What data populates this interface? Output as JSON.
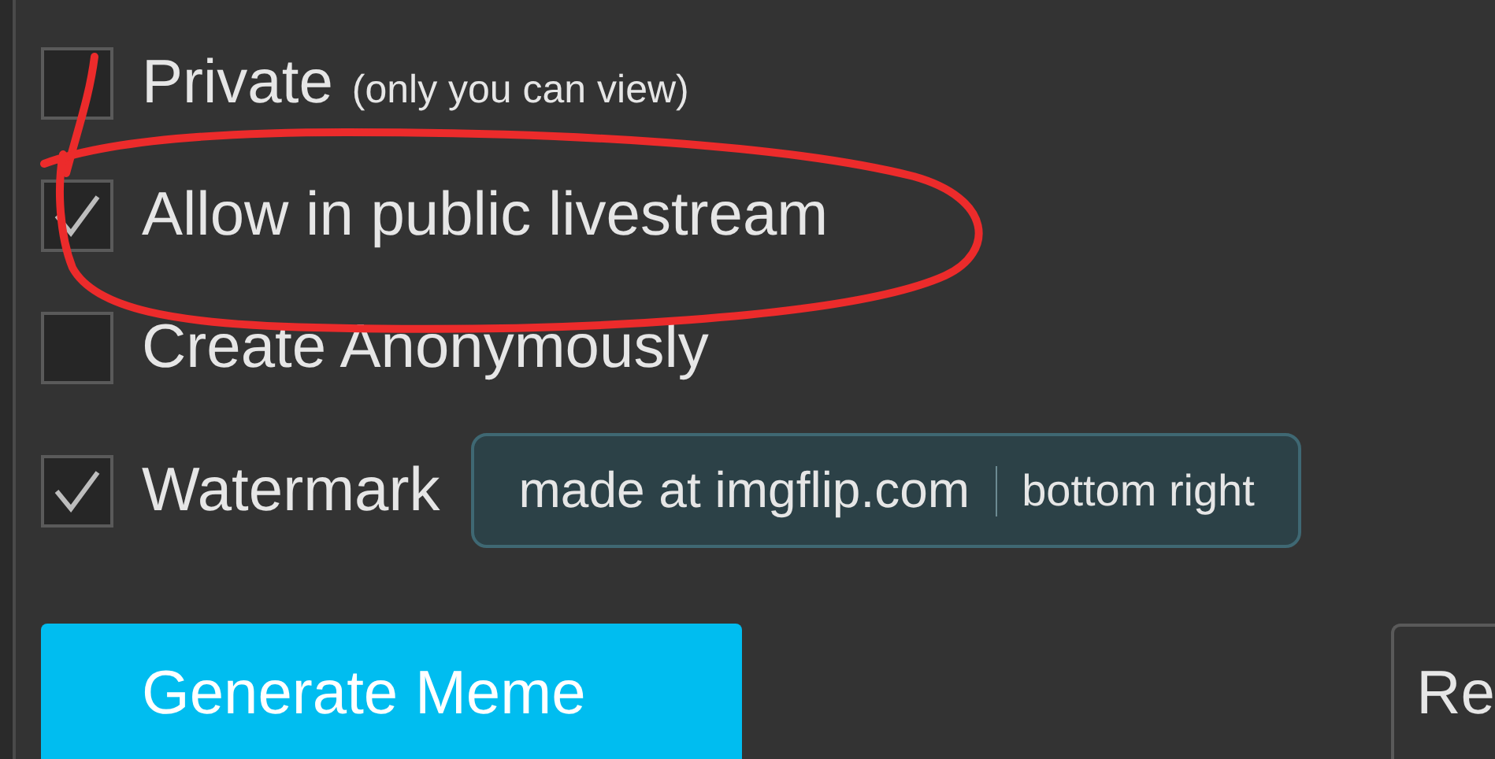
{
  "options": [
    {
      "label": "Private",
      "note": "(only you can view)",
      "checked": false
    },
    {
      "label": "Allow in public livestream",
      "checked": true
    },
    {
      "label": "Create Anonymously",
      "checked": false
    },
    {
      "label": "Watermark",
      "checked": true,
      "field": {
        "text": "made at imgflip.com",
        "position": "bottom right"
      }
    }
  ],
  "buttons": [
    {
      "label": "Generate Meme",
      "kind": "primary"
    },
    {
      "label": "Re",
      "kind": "secondary"
    }
  ]
}
